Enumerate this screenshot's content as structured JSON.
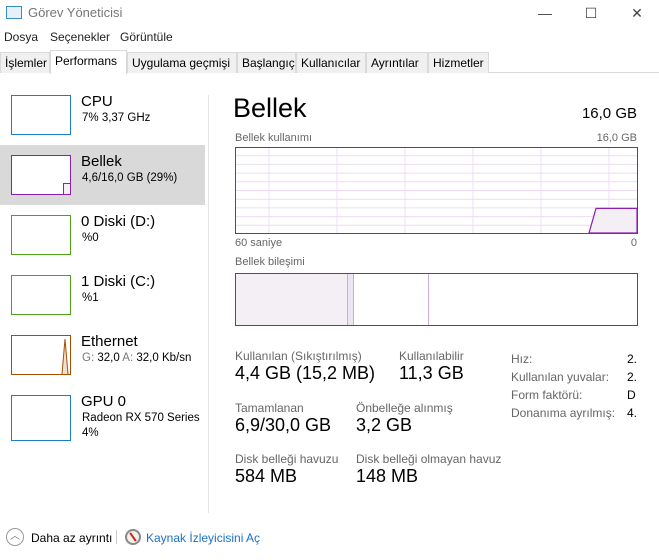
{
  "window": {
    "title": "Görev Yöneticisi",
    "minimize": "—",
    "maximize": "☐",
    "close": "✕"
  },
  "menu": [
    "Dosya",
    "Seçenekler",
    "Görüntüle"
  ],
  "tabs": [
    "İşlemler",
    "Performans",
    "Uygulama geçmişi",
    "Başlangıç",
    "Kullanıcılar",
    "Ayrıntılar",
    "Hizmetler"
  ],
  "active_tab": "Performans",
  "sidebar": [
    {
      "name": "CPU",
      "sub": "7% 3,37 GHz",
      "color": "#1c7dc2"
    },
    {
      "name": "Bellek",
      "sub": "4,6/16,0 GB (29%)",
      "color": "#8b1eb3",
      "selected": true
    },
    {
      "name": "0 Diski (D:)",
      "sub": "%0",
      "color": "#4ea017"
    },
    {
      "name": "1 Diski (C:)",
      "sub": "%1",
      "color": "#4ea017"
    },
    {
      "name": "Ethernet",
      "sub_g": "G:",
      "sub_gv": "32,0",
      "sub_a": "A:",
      "sub_av": "32,0 Kb/sn",
      "color": "#a74f01"
    },
    {
      "name": "GPU 0",
      "sub": "Radeon RX 570 Series",
      "sub2": "4%",
      "color": "#1c7dc2"
    }
  ],
  "main": {
    "title": "Bellek",
    "total": "16,0 GB",
    "usage_label": "Bellek kullanımı",
    "usage_max": "16,0 GB",
    "time_left": "60 saniye",
    "time_right": "0",
    "composition_label": "Bellek bileşimi",
    "usage_percent": 29,
    "stats": [
      {
        "label": "Kullanılan (Sıkıştırılmış)",
        "value": "4,4 GB (15,2 MB)"
      },
      {
        "label": "Kullanılabilir",
        "value": "11,3 GB"
      },
      {
        "label": "Tamamlanan",
        "value": "6,9/30,0 GB"
      },
      {
        "label": "Önbelleğe alınmış",
        "value": "3,2 GB"
      },
      {
        "label": "Disk belleği havuzu",
        "value": "584 MB"
      },
      {
        "label": "Disk belleği olmayan havuz",
        "value": "148 MB"
      }
    ],
    "details": [
      {
        "label": "Hız:",
        "value": "2."
      },
      {
        "label": "Kullanılan yuvalar:",
        "value": "2."
      },
      {
        "label": "Form faktörü:",
        "value": "D"
      },
      {
        "label": "Donanıma ayrılmış:",
        "value": "4."
      }
    ]
  },
  "footer": {
    "less_details": "Daha az ayrıntı",
    "open_monitor": "Kaynak İzleyicisini Aç"
  }
}
